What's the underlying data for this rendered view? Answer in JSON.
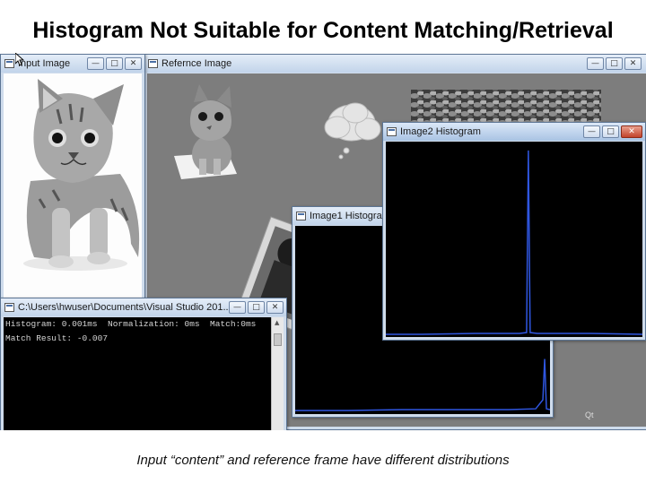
{
  "slide": {
    "title": "Histogram Not Suitable for Content Matching/Retrieval",
    "caption": "Input “content” and reference frame have different distributions"
  },
  "windows": {
    "input": {
      "title": "Input Image"
    },
    "reference": {
      "title": "Refernce Image",
      "qt_label": "Qt"
    },
    "console": {
      "title": "C:\\Users\\hwuser\\Documents\\Visual Studio 201...",
      "lines": [
        "Histogram: 0.001ms  Normalization: 0ms  Match:0ms",
        "Match Result: -0.007"
      ]
    },
    "hist1": {
      "title": "Image1 Histogram"
    },
    "hist2": {
      "title": "Image2 Histogram"
    }
  },
  "controls": {
    "minimize": "—",
    "maximize": "□",
    "close": "✕"
  },
  "colors": {
    "titlebar": "#c2d4ea",
    "histogram_line": "#2f56e0",
    "console_bg": "#000000"
  },
  "icons": [
    "app-icon",
    "minimize-icon",
    "maximize-icon",
    "close-icon",
    "mouse-cursor-icon",
    "cloud-icon"
  ]
}
